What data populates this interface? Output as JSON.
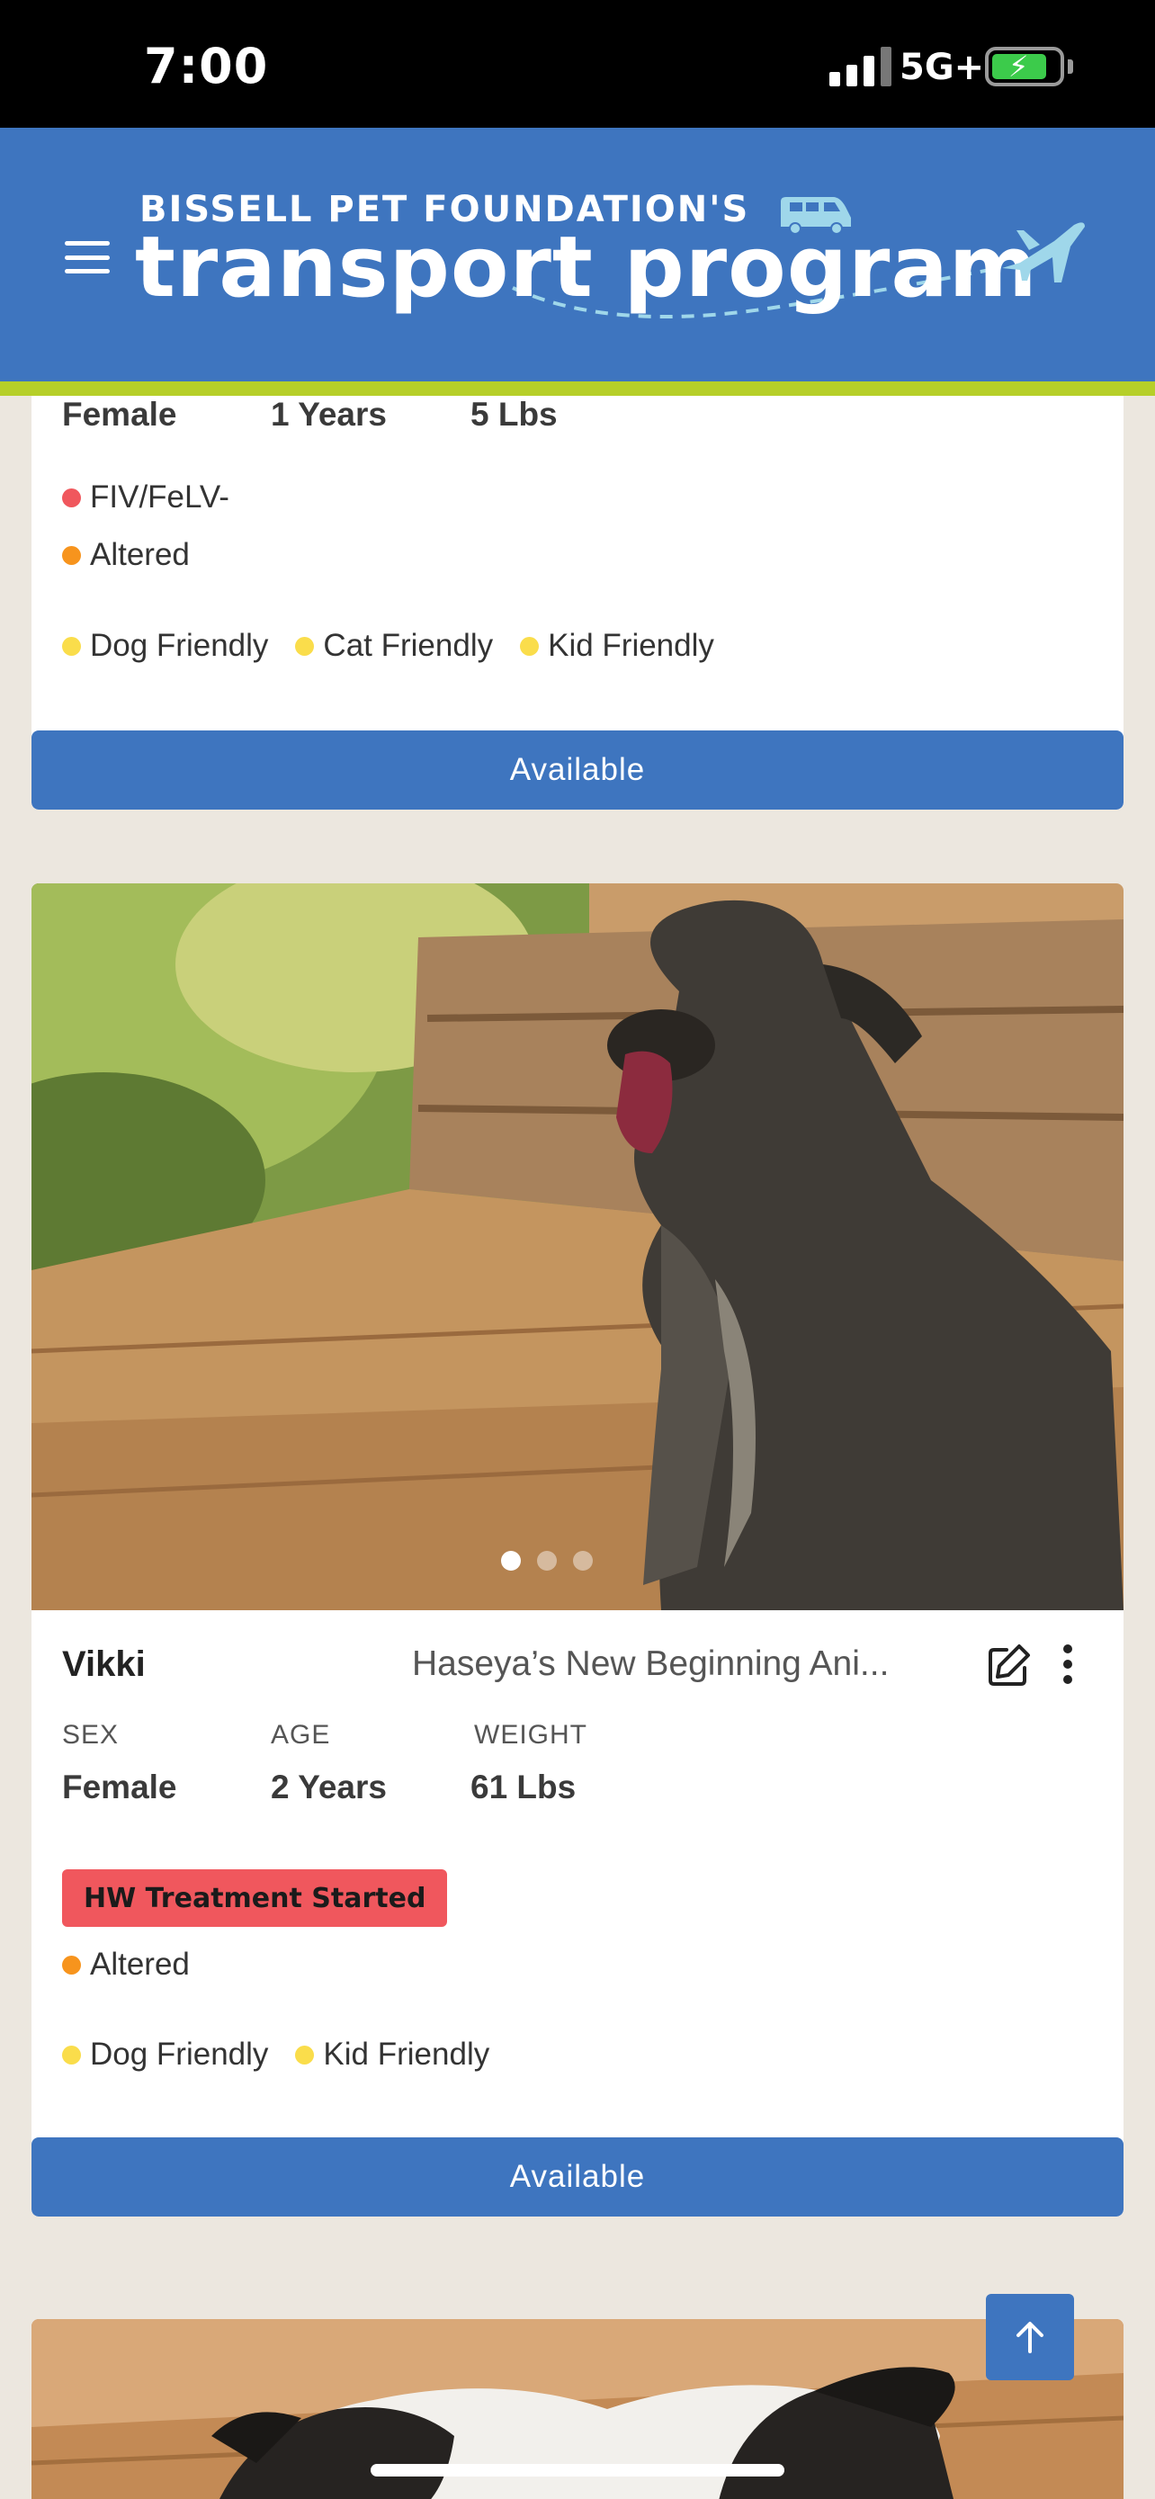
{
  "status_bar": {
    "time": "7:00",
    "network": "5G+",
    "battery_charging": true
  },
  "header": {
    "brand_top": "BISSELL PET FOUNDATION'S",
    "brand_main": "transport program",
    "menu_icon": "hamburger-menu-icon",
    "colors": {
      "header_bg": "#3e75bf",
      "accent_stripe": "#b6cf29"
    }
  },
  "cards": [
    {
      "stats": {
        "sex": "Female",
        "age": "1 Years",
        "weight": "5 Lbs"
      },
      "medical_tags": [
        {
          "label": "FIV/FeLV-",
          "color": "#f0575d"
        },
        {
          "label": "Altered",
          "color": "#f7941d"
        }
      ],
      "traits": [
        "Dog Friendly",
        "Cat Friendly",
        "Kid Friendly"
      ],
      "button_label": "Available"
    },
    {
      "name": "Vikki",
      "rescue": "Haseya’s New Beginning Ani...",
      "stat_labels": {
        "sex": "SEX",
        "age": "AGE",
        "weight": "WEIGHT"
      },
      "stats": {
        "sex": "Female",
        "age": "2 Years",
        "weight": "61 Lbs"
      },
      "badge": "HW Treatment Started",
      "medical_tags": [
        {
          "label": "Altered",
          "color": "#f7941d"
        }
      ],
      "traits": [
        "Dog Friendly",
        "Kid Friendly"
      ],
      "button_label": "Available",
      "carousel": {
        "count": 3,
        "active": 1
      }
    }
  ],
  "scroll_top_icon": "arrow-up-icon"
}
